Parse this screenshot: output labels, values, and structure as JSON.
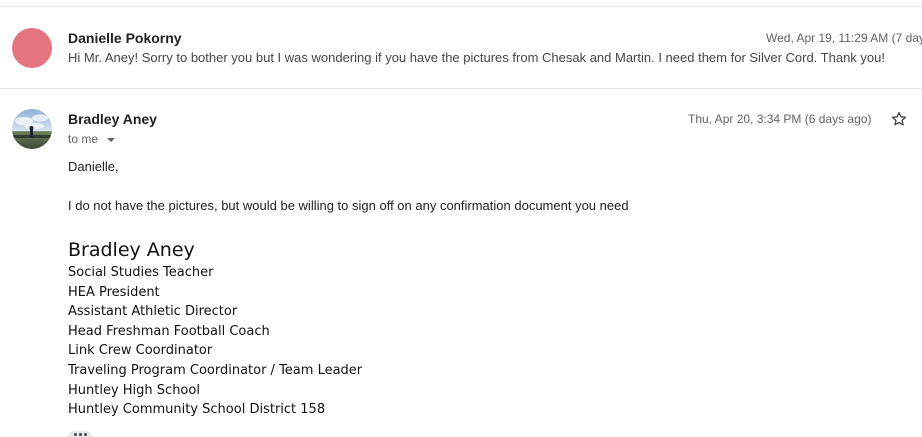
{
  "messages": [
    {
      "sender": "Danielle Pokorny",
      "date": "Wed, Apr 19, 11:29 AM (7 days",
      "snippet": "Hi Mr. Aney! Sorry to bother you but I was wondering if you have the pictures from Chesak and Martin. I need them for Silver Cord. Thank you!",
      "avatar_color": "#e57481"
    },
    {
      "sender": "Bradley Aney",
      "date": "Thu, Apr 20, 3:34 PM (6 days ago)",
      "recipients": "to me",
      "greeting": "Danielle,",
      "body": "I do not have the pictures, but would be willing to sign off on any confirmation document you need",
      "signature": {
        "name": "Bradley Aney",
        "lines": [
          "Social Studies Teacher",
          "HEA President",
          "Assistant Athletic Director",
          "Head Freshman Football Coach",
          "Link Crew Coordinator",
          "Traveling Program Coordinator / Team Leader",
          "Huntley High School",
          "Huntley Community School District 158"
        ]
      }
    }
  ],
  "icons": {
    "star": "star-outline-icon",
    "caret": "chevron-down-icon",
    "more": "more-horizontal-icon"
  }
}
